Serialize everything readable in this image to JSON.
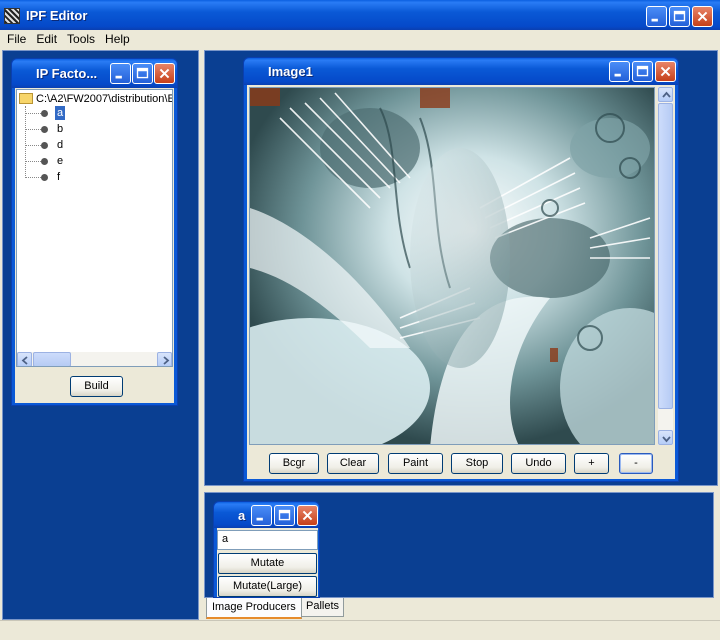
{
  "app": {
    "title": "IPF Editor"
  },
  "menu": [
    "File",
    "Edit",
    "Tools",
    "Help"
  ],
  "factory_window": {
    "title": "IP Facto...",
    "root_path": "C:\\A2\\FW2007\\distribution\\E",
    "items": [
      "a",
      "b",
      "d",
      "e",
      "f"
    ],
    "selected_item": "a",
    "build_label": "Build"
  },
  "image_window": {
    "title": "Image1",
    "buttons": [
      "Bcgr",
      "Clear",
      "Paint",
      "Stop",
      "Undo",
      "+",
      "-"
    ]
  },
  "producer_window": {
    "title": "a",
    "field_value": "a",
    "mutate_label": "Mutate",
    "mutate_large_label": "Mutate(Large)"
  },
  "tabs": [
    "Image Producers",
    "Pallets"
  ],
  "colors": {
    "desktop": "#0a3f92",
    "titlebar": "#0a59d6",
    "chrome": "#ece9d8"
  }
}
